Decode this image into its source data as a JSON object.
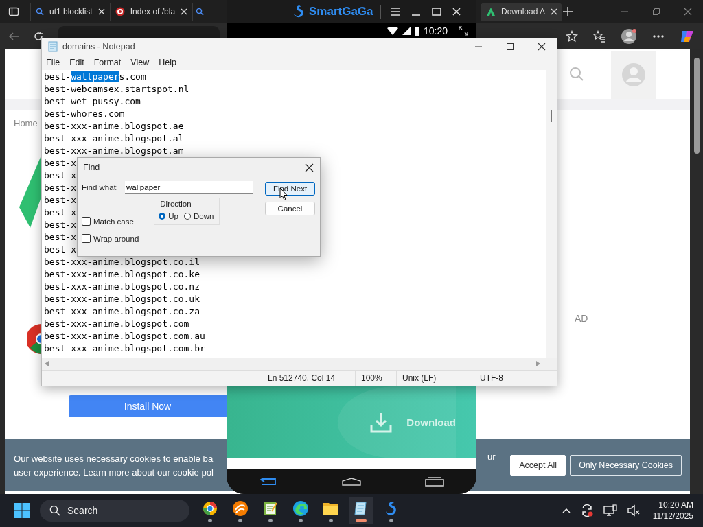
{
  "browser": {
    "tabs": [
      {
        "title": "ut1 blocklist",
        "selected": false
      },
      {
        "title": "Index of /bla",
        "selected": false
      },
      {
        "selected": false
      },
      {
        "title": "Download A",
        "selected": true
      }
    ]
  },
  "page": {
    "breadcrumb": "Home",
    "ad_label": "AD",
    "install_button": "Install Now"
  },
  "cookie_banner": {
    "lines": [
      "Our website uses necessary cookies to enable ba",
      "user experience. Learn more about our cookie pol"
    ],
    "tail": "ur",
    "buttons": [
      {
        "label": "Accept All",
        "kind": "filled"
      },
      {
        "label": "Only Necessary Cookies",
        "kind": "outline"
      }
    ]
  },
  "emulator": {
    "title": "SmartGaGa",
    "time": "10:20",
    "download_button": "Download"
  },
  "notepad": {
    "title": "domains - Notepad",
    "menu": [
      "File",
      "Edit",
      "Format",
      "View",
      "Help"
    ],
    "lines": [
      {
        "segments": [
          {
            "text": "best-",
            "selected": false
          },
          {
            "text": "wallpaper",
            "selected": true
          },
          {
            "text": "s.com",
            "selected": false
          }
        ]
      },
      {
        "text": "best-webcamsex.startspot.nl"
      },
      {
        "text": "best-wet-pussy.com"
      },
      {
        "text": "best-whores.com"
      },
      {
        "text": "best-xxx-anime.blogspot.ae"
      },
      {
        "text": "best-xxx-anime.blogspot.al"
      },
      {
        "text": "best-xxx-anime.blogspot.am"
      },
      {
        "text": "best-x"
      },
      {
        "text": "best-x"
      },
      {
        "text": "best-x"
      },
      {
        "text": "best-x"
      },
      {
        "text": "best-x"
      },
      {
        "text": "best-x"
      },
      {
        "text": "best-x"
      },
      {
        "text": "best-x"
      },
      {
        "text": "best-xxx-anime.blogspot.co.il"
      },
      {
        "text": "best-xxx-anime.blogspot.co.ke"
      },
      {
        "text": "best-xxx-anime.blogspot.co.nz"
      },
      {
        "text": "best-xxx-anime.blogspot.co.uk"
      },
      {
        "text": "best-xxx-anime.blogspot.co.za"
      },
      {
        "text": "best-xxx-anime.blogspot.com"
      },
      {
        "text": "best-xxx-anime.blogspot.com.au"
      },
      {
        "text": "best-xxx-anime.blogspot.com.br"
      }
    ],
    "status": [
      "Ln 512740, Col 14",
      "100%",
      "Unix (LF)",
      "UTF-8"
    ]
  },
  "find_dialog": {
    "title": "Find",
    "label": "Find what:",
    "value": "wallpaper",
    "buttons": [
      {
        "label": "Find Next",
        "focused": true
      },
      {
        "label": "Cancel",
        "focused": false
      }
    ],
    "options": [
      {
        "label": "Match case",
        "checked": false
      },
      {
        "label": "Wrap around",
        "checked": false
      }
    ],
    "direction": {
      "label": "Direction",
      "options": [
        {
          "label": "Up",
          "selected": true
        },
        {
          "label": "Down",
          "selected": false
        }
      ]
    }
  },
  "taskbar": {
    "search": "Search",
    "apps": [
      {
        "kind": "ring",
        "active": false
      },
      {
        "kind": "swirl",
        "active": false
      },
      {
        "kind": "notepad-green",
        "active": false
      },
      {
        "kind": "edge",
        "active": false
      },
      {
        "kind": "folder",
        "active": false
      },
      {
        "kind": "notepad-blue",
        "active": true
      },
      {
        "kind": "swan",
        "active": false
      }
    ],
    "time": "10:20 AM",
    "date": "11/12/2025"
  }
}
